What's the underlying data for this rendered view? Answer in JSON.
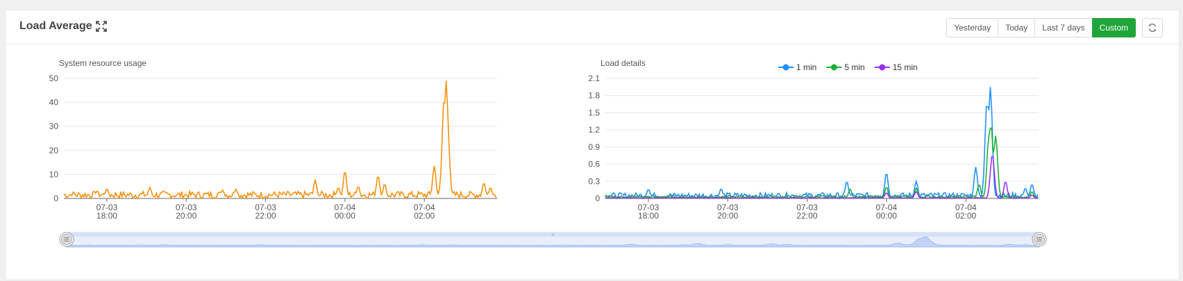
{
  "header": {
    "title": "Load Average",
    "expand_icon": "expand-icon",
    "refresh_icon": "refresh-icon",
    "range_buttons": [
      {
        "label": "Yesterday",
        "active": false
      },
      {
        "label": "Today",
        "active": false
      },
      {
        "label": "Last 7 days",
        "active": false
      },
      {
        "label": "Custom",
        "active": true
      }
    ]
  },
  "colors": {
    "accent": "#20a53a",
    "usage": "#f7900f",
    "series_1min": "#1e90ff",
    "series_5min": "#20b03a",
    "series_15min": "#9932f0",
    "zoom_fill": "#dce6fb",
    "zoom_line": "#aabff0"
  },
  "chart_data": [
    {
      "type": "line",
      "title": "System resource usage",
      "ylim": [
        0,
        50
      ],
      "yticks": [
        0,
        10,
        20,
        30,
        40,
        50
      ],
      "xlim": [
        "07-03 16:55",
        "07-04 03:50"
      ],
      "xticks": [
        {
          "label": [
            "07-03",
            "18:00"
          ],
          "t": "07-03 18:00"
        },
        {
          "label": [
            "07-03",
            "20:00"
          ],
          "t": "07-03 20:00"
        },
        {
          "label": [
            "07-03",
            "22:00"
          ],
          "t": "07-03 22:00"
        },
        {
          "label": [
            "07-04",
            "00:00"
          ],
          "t": "07-04 00:00"
        },
        {
          "label": [
            "07-04",
            "02:00"
          ],
          "t": "07-04 02:00"
        }
      ],
      "series": [
        {
          "color": "#f7900f",
          "baseline": 1.5,
          "noise": 1.5,
          "peaks": [
            {
              "t": "07-03 17:10",
              "y": 2.5
            },
            {
              "t": "07-03 17:45",
              "y": 3
            },
            {
              "t": "07-03 18:00",
              "y": 4
            },
            {
              "t": "07-03 19:05",
              "y": 4.5
            },
            {
              "t": "07-03 20:55",
              "y": 3.5
            },
            {
              "t": "07-03 21:15",
              "y": 3.8
            },
            {
              "t": "07-03 23:15",
              "y": 7.5
            },
            {
              "t": "07-03 23:50",
              "y": 4.5
            },
            {
              "t": "07-04 00:00",
              "y": 11.5
            },
            {
              "t": "07-04 00:20",
              "y": 5
            },
            {
              "t": "07-04 00:50",
              "y": 9.5
            },
            {
              "t": "07-04 01:00",
              "y": 6
            },
            {
              "t": "07-04 02:15",
              "y": 13.5
            },
            {
              "t": "07-04 02:25",
              "y": 6
            },
            {
              "t": "07-04 02:30",
              "y": 42
            },
            {
              "t": "07-04 02:33",
              "y": 49
            },
            {
              "t": "07-04 02:35",
              "y": 30
            },
            {
              "t": "07-04 03:30",
              "y": 6.5
            },
            {
              "t": "07-04 03:40",
              "y": 4.5
            }
          ]
        }
      ]
    },
    {
      "type": "line",
      "title": "Load details",
      "ylim": [
        0,
        2.1
      ],
      "yticks": [
        "0",
        "0.3",
        "0.6",
        "0.9",
        "1.2",
        "1.5",
        "1.8",
        "2.1"
      ],
      "xlim": [
        "07-03 16:55",
        "07-04 03:50"
      ],
      "xticks": [
        {
          "label": [
            "07-03",
            "18:00"
          ],
          "t": "07-03 18:00"
        },
        {
          "label": [
            "07-03",
            "20:00"
          ],
          "t": "07-03 20:00"
        },
        {
          "label": [
            "07-03",
            "22:00"
          ],
          "t": "07-03 22:00"
        },
        {
          "label": [
            "07-04",
            "00:00"
          ],
          "t": "07-04 00:00"
        },
        {
          "label": [
            "07-04",
            "02:00"
          ],
          "t": "07-04 02:00"
        }
      ],
      "legend": {
        "position": "top-center",
        "items": [
          "1 min",
          "5 min",
          "15 min"
        ]
      },
      "series": [
        {
          "name": "1 min",
          "color": "#1e90ff",
          "baseline": 0.05,
          "noise": 0.05,
          "peaks": [
            {
              "t": "07-03 18:00",
              "y": 0.16
            },
            {
              "t": "07-03 19:50",
              "y": 0.17
            },
            {
              "t": "07-03 23:00",
              "y": 0.3
            },
            {
              "t": "07-04 00:00",
              "y": 0.45
            },
            {
              "t": "07-04 00:45",
              "y": 0.3
            },
            {
              "t": "07-04 02:15",
              "y": 0.55
            },
            {
              "t": "07-04 02:32",
              "y": 1.7
            },
            {
              "t": "07-04 02:37",
              "y": 1.95
            },
            {
              "t": "07-04 03:30",
              "y": 0.18
            },
            {
              "t": "07-04 03:40",
              "y": 0.25
            }
          ]
        },
        {
          "name": "5 min",
          "color": "#20b03a",
          "baseline": 0.03,
          "noise": 0.02,
          "peaks": [
            {
              "t": "07-03 23:05",
              "y": 0.16
            },
            {
              "t": "07-04 00:00",
              "y": 0.2
            },
            {
              "t": "07-04 00:45",
              "y": 0.18
            },
            {
              "t": "07-04 02:20",
              "y": 0.25
            },
            {
              "t": "07-04 02:35",
              "y": 1.1
            },
            {
              "t": "07-04 02:38",
              "y": 1.3
            },
            {
              "t": "07-04 02:45",
              "y": 1.1
            },
            {
              "t": "07-04 03:40",
              "y": 0.12
            }
          ]
        },
        {
          "name": "15 min",
          "color": "#9932f0",
          "baseline": 0.01,
          "noise": 0.005,
          "peaks": [
            {
              "t": "07-04 00:00",
              "y": 0.1
            },
            {
              "t": "07-04 00:45",
              "y": 0.12
            },
            {
              "t": "07-04 02:40",
              "y": 0.77
            },
            {
              "t": "07-04 03:00",
              "y": 0.3
            },
            {
              "t": "07-04 03:40",
              "y": 0.06
            }
          ]
        }
      ]
    }
  ],
  "zoom": {
    "start": "07-03 16:55",
    "end": "07-04 03:50"
  }
}
